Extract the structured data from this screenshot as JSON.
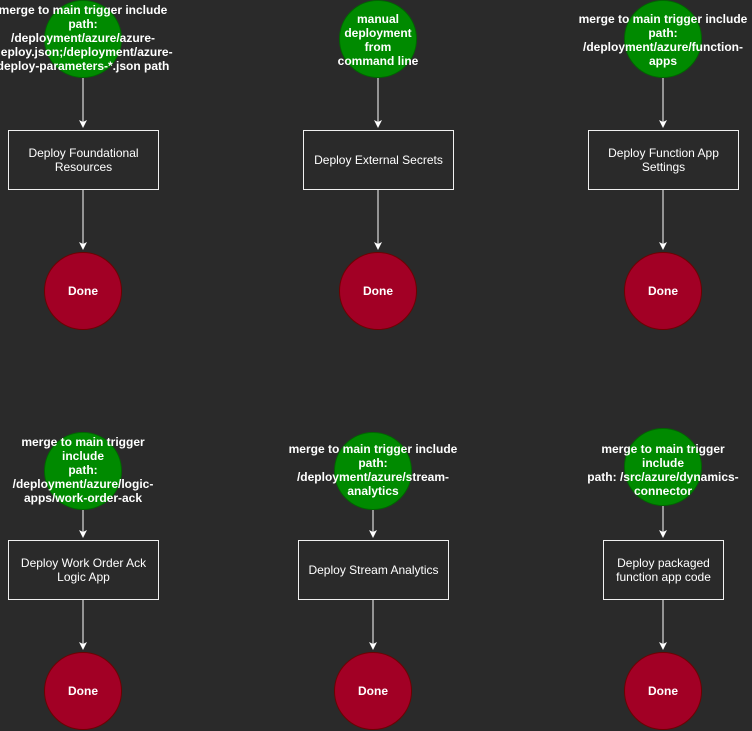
{
  "colors": {
    "background": "#2a2a2a",
    "start_node": "#008a00",
    "done_node": "#a20025",
    "box_border": "#f0f0f0",
    "edge": "#ffffff",
    "text": "#ffffff"
  },
  "flows": [
    {
      "trigger": "merge to main trigger include\npath:\n/deployment/azure/azure-\ndeploy.json;/deployment/azure-\ndeploy-parameters-*.json path",
      "step": "Deploy Foundational\nResources",
      "end": "Done"
    },
    {
      "trigger": "manual\ndeployment\nfrom\ncommand line",
      "step": "Deploy External Secrets",
      "end": "Done"
    },
    {
      "trigger": "merge to main trigger include\npath: /deployment/azure/function-\napps",
      "step": "Deploy Function App\nSettings",
      "end": "Done"
    },
    {
      "trigger": "merge to main trigger include\npath: /deployment/azure/logic-\napps/work-order-ack",
      "step": "Deploy Work Order Ack\nLogic App",
      "end": "Done"
    },
    {
      "trigger": "merge to main trigger include\npath: /deployment/azure/stream-\nanalytics",
      "step": "Deploy Stream Analytics",
      "end": "Done"
    },
    {
      "trigger": "merge to main trigger\ninclude\npath: /src/azure/dynamics-\nconnector",
      "step": "Deploy packaged\nfunction app code",
      "end": "Done"
    }
  ]
}
